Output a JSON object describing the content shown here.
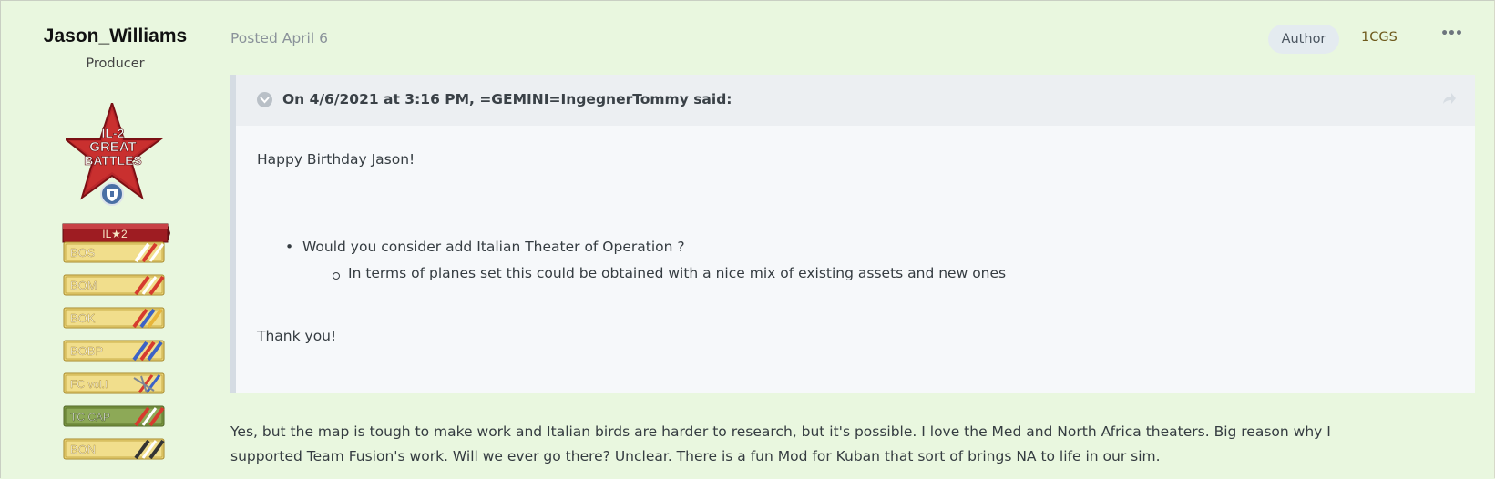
{
  "author": {
    "name": "Jason_Williams",
    "title": "Producer",
    "badge": "IL-2 GREAT BATTLES",
    "rank": "IL★2",
    "ribbons": [
      "BOS",
      "BOM",
      "BOK",
      "BOBP",
      "FC vol.I",
      "TC CAP",
      "BON"
    ]
  },
  "post": {
    "date": "Posted April 6",
    "author_badge": "Author",
    "group": "1CGS",
    "more": "•••"
  },
  "quote": {
    "citation": "On 4/6/2021 at 3:16 PM, =GEMINI=IngegnerTommy said:",
    "line1": "Happy Birthday Jason!",
    "bullet1": "Would you consider add Italian Theater of Operation ?",
    "bullet2": "In terms of planes set this could be obtained with a nice mix of existing assets and new ones",
    "thanks": "Thank you!"
  },
  "reply": {
    "line1": "Yes, but the map is tough to make work and Italian birds are harder to research, but it's possible. I love the Med and North Africa theaters. Big reason why I",
    "line2": "supported Team Fusion's work. Will we ever go there? Unclear. There is a fun Mod for Kuban that sort of brings NA to life in our sim."
  },
  "colors": {
    "page_bg": "#e9f7df",
    "quote_bg": "#f6f8fa",
    "quote_header_bg": "#eceff2",
    "badge_bg": "#e4ebf0",
    "group_color": "#6e5a1c",
    "star_red": "#b8262a"
  },
  "icons": {
    "toggle": "chevron-down-icon",
    "share": "share-arrow-icon",
    "more": "ellipsis-icon"
  }
}
